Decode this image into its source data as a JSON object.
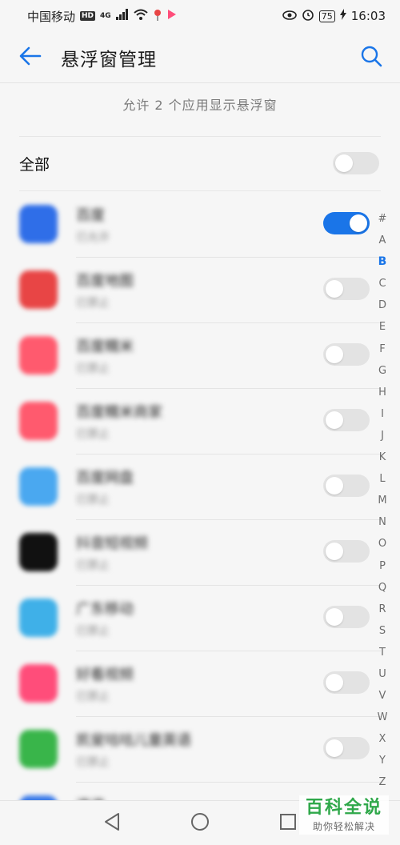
{
  "status_bar": {
    "carrier": "中国移动",
    "hd": "HD",
    "network": "4G",
    "battery": "75",
    "time": "16:03"
  },
  "header": {
    "title": "悬浮窗管理",
    "back_icon": "back-arrow-icon",
    "search_icon": "search-icon"
  },
  "summary": "允许 2 个应用显示悬浮窗",
  "all_toggle": {
    "label": "全部",
    "on": false
  },
  "apps": [
    {
      "name": "百度",
      "status": "已允许",
      "on": true,
      "icon_color": "#2f6ee8"
    },
    {
      "name": "百度地图",
      "status": "已禁止",
      "on": false,
      "icon_color": "#e84545"
    },
    {
      "name": "百度糯米",
      "status": "已禁止",
      "on": false,
      "icon_color": "#ff5a6e"
    },
    {
      "name": "百度糯米商家",
      "status": "已禁止",
      "on": false,
      "icon_color": "#ff5a6e"
    },
    {
      "name": "百度网盘",
      "status": "已禁止",
      "on": false,
      "icon_color": "#4aa8f0"
    },
    {
      "name": "抖音短视频",
      "status": "已禁止",
      "on": false,
      "icon_color": "#111111"
    },
    {
      "name": "广东移动",
      "status": "已禁止",
      "on": false,
      "icon_color": "#3fb0e8"
    },
    {
      "name": "好看视频",
      "status": "已禁止",
      "on": false,
      "icon_color": "#ff4d7a"
    },
    {
      "name": "凯叟咕咕儿童英语",
      "status": "已禁止",
      "on": false,
      "icon_color": "#39b54a"
    },
    {
      "name": "滴滴",
      "status": "",
      "on": false,
      "icon_color": "#3a7ae8"
    }
  ],
  "index_letters": [
    "#",
    "A",
    "B",
    "C",
    "D",
    "E",
    "F",
    "G",
    "H",
    "I",
    "J",
    "K",
    "L",
    "M",
    "N",
    "O",
    "P",
    "Q",
    "R",
    "S",
    "T",
    "U",
    "V",
    "W",
    "X",
    "Y",
    "Z"
  ],
  "index_active": "B",
  "nav": {
    "back_icon": "nav-back-icon",
    "home_icon": "nav-home-icon",
    "recent_icon": "nav-recent-icon"
  },
  "watermark": {
    "title": "百科全说",
    "subtitle": "助你轻松解决"
  },
  "colors": {
    "accent": "#1a75e8",
    "watermark_green": "#2fa84a"
  }
}
